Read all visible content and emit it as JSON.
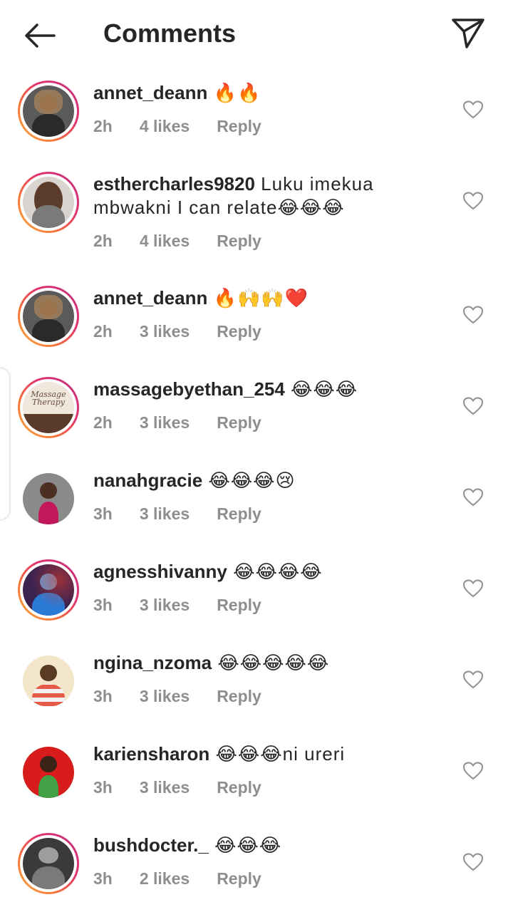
{
  "header": {
    "title": "Comments"
  },
  "labels": {
    "reply": "Reply"
  },
  "colors": {
    "meta_gray": "#8e8e8e",
    "text": "#262626",
    "story_ring": [
      "#fcaf45",
      "#e1306c",
      "#c13584"
    ]
  },
  "comments": [
    {
      "username": "annet_deann",
      "text": " 🔥🔥",
      "time": "2h",
      "likes": "4 likes",
      "reply": "Reply",
      "story_ring": true
    },
    {
      "username": "esthercharles9820",
      "text": " Luku imekua mbwakni I can relate😂😂😂",
      "time": "2h",
      "likes": "4 likes",
      "reply": "Reply",
      "story_ring": true
    },
    {
      "username": "annet_deann",
      "text": " 🔥🙌🙌❤️",
      "time": "2h",
      "likes": "3 likes",
      "reply": "Reply",
      "story_ring": true
    },
    {
      "username": "massagebyethan_254",
      "text": " 😂😂😂",
      "time": "2h",
      "likes": "3 likes",
      "reply": "Reply",
      "story_ring": true,
      "avatar_text": "Massage Therapy"
    },
    {
      "username": "nanahgracie",
      "text": " 😂😂😂😢",
      "time": "3h",
      "likes": "3 likes",
      "reply": "Reply",
      "story_ring": false
    },
    {
      "username": "agnesshivanny",
      "text": " 😂😂😂😂",
      "time": "3h",
      "likes": "3 likes",
      "reply": "Reply",
      "story_ring": true
    },
    {
      "username": "ngina_nzoma",
      "text": " 😂😂😂😂😂",
      "time": "3h",
      "likes": "3 likes",
      "reply": "Reply",
      "story_ring": false
    },
    {
      "username": "kariensharon",
      "text": " 😂😂😂ni ureri",
      "time": "3h",
      "likes": "3 likes",
      "reply": "Reply",
      "story_ring": false
    },
    {
      "username": "bushdocter._",
      "text": " 😂😂😂",
      "time": "3h",
      "likes": "2 likes",
      "reply": "Reply",
      "story_ring": true
    }
  ]
}
